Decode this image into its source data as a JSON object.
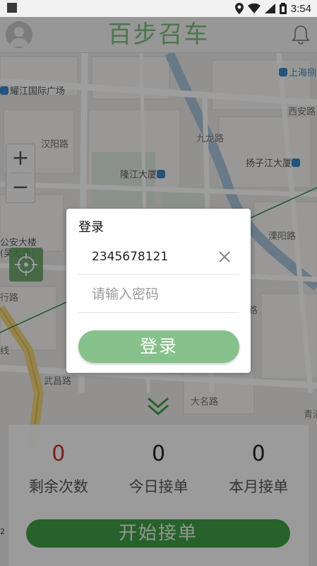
{
  "status_bar": {
    "time": "3:54"
  },
  "header": {
    "title": "百步召车"
  },
  "map": {
    "labels": {
      "shanghai": "上海捌",
      "yaojiang": "耀江国际广场",
      "xiansu": "西安路",
      "hanyang": "汉阳路",
      "jiulong": "九龙路",
      "longjiang": "隆江大厦",
      "yangzijiang": "扬子江大厦",
      "gongan": "公安大楼",
      "gongan_sub": "(吴淞路)",
      "liyang": "溧阳路",
      "xinglu": "行路",
      "lu_right": "路",
      "wuchang": "武昌路",
      "daming": "大名路",
      "qingpu": "青浦",
      "left_da": "大",
      "right_han": "浦",
      "line_label": "线"
    },
    "zoom_in": "+",
    "zoom_out": "−",
    "corner": "2"
  },
  "stats": [
    {
      "value": "0",
      "label": "剩余次数"
    },
    {
      "value": "0",
      "label": "今日接单"
    },
    {
      "value": "0",
      "label": "本月接单"
    }
  ],
  "start_button": "开始接单",
  "dialog": {
    "title": "登录",
    "phone_value": "2345678121",
    "password_placeholder": "请输入密码",
    "login_button": "登录"
  },
  "colors": {
    "brand_green": "#7cbf7c",
    "button_green": "#3f9e46",
    "login_green": "#86c18c",
    "accent_red": "#c8312f"
  }
}
